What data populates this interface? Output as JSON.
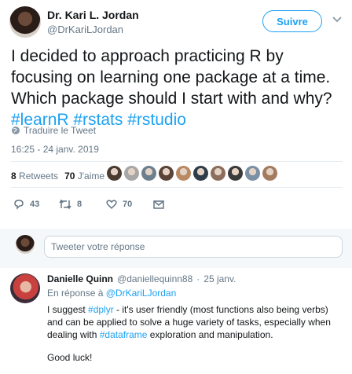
{
  "tweet": {
    "author_name": "Dr. Kari L. Jordan",
    "author_handle": "@DrKariLJordan",
    "follow_label": "Suivre",
    "text": "I decided to approach practicing R by focusing on learning one package at a time. Which package should I start with and why?",
    "hashtags": "#learnR #rstats #rstudio",
    "translate_label": "Traduire le Tweet",
    "timestamp": "16:25 - 24 janv. 2019",
    "retweets_count": "8",
    "retweets_label": "Retweets",
    "likes_count": "70",
    "likes_label": "J'aime",
    "reply_count": "43",
    "retweet_action_count": "8",
    "like_action_count": "70"
  },
  "composer": {
    "placeholder": "Tweeter votre réponse"
  },
  "reply": {
    "name": "Danielle Quinn",
    "handle": "@daniellequinn88",
    "separator": "·",
    "date": "25 janv.",
    "in_reply_prefix": "En réponse à",
    "in_reply_handle": "@DrKariLJordan",
    "body_1a": "I suggest ",
    "body_1_tag": "#dplyr",
    "body_1b": " - it's user friendly (most functions also being verbs) and can be applied to solve a huge variety of tasks, especially when dealing with ",
    "body_1_tag2": "#dataframe",
    "body_1c": " exploration and manipulation.",
    "body_2": "Good luck!"
  },
  "colors": {
    "accent": "#1da1f2",
    "muted": "#657786",
    "like_avatars": [
      "#4b3a2f",
      "#a7a7a7",
      "#6b7f8f",
      "#5b4338",
      "#b98a63",
      "#2f3d4a",
      "#8b6e5b",
      "#3a3a3a",
      "#7b8fa5",
      "#a37b5e"
    ]
  }
}
